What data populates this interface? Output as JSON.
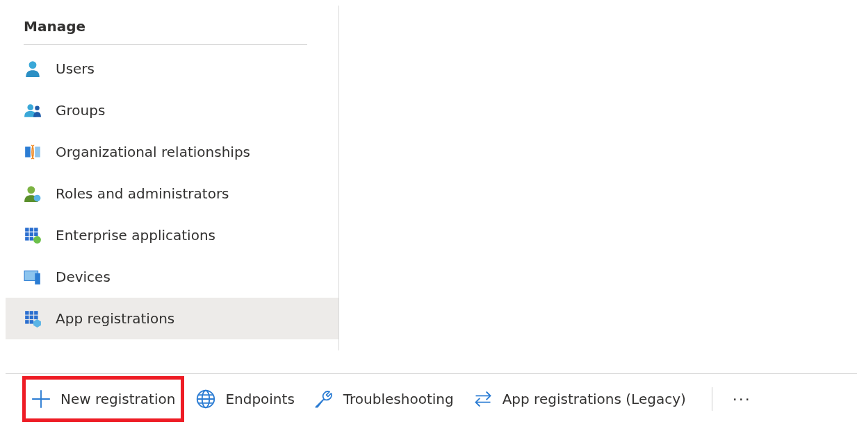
{
  "sidebar": {
    "heading": "Manage",
    "items": [
      {
        "label": "Users",
        "kind": "user",
        "selected": false
      },
      {
        "label": "Groups",
        "kind": "group",
        "selected": false
      },
      {
        "label": "Organizational relationships",
        "kind": "org",
        "selected": false
      },
      {
        "label": "Roles and administrators",
        "kind": "roles",
        "selected": false
      },
      {
        "label": "Enterprise applications",
        "kind": "enterprise",
        "selected": false
      },
      {
        "label": "Devices",
        "kind": "devices",
        "selected": false
      },
      {
        "label": "App registrations",
        "kind": "app",
        "selected": true
      }
    ]
  },
  "toolbar": {
    "items": [
      {
        "label": "New registration",
        "kind": "plus",
        "highlighted": true
      },
      {
        "label": "Endpoints",
        "kind": "globe",
        "highlighted": false
      },
      {
        "label": "Troubleshooting",
        "kind": "wrench",
        "highlighted": false
      },
      {
        "label": "App registrations (Legacy)",
        "kind": "swap",
        "highlighted": false
      }
    ],
    "more": "···"
  }
}
